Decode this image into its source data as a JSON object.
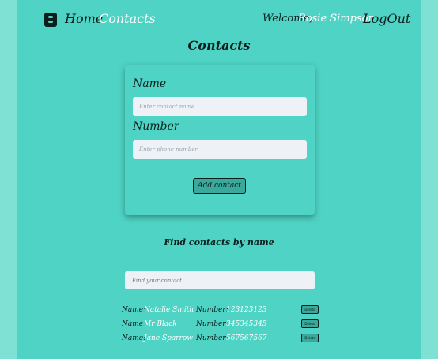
{
  "nav": {
    "home": "Home",
    "contacts": "Contacts",
    "welcome": "Welcome,",
    "user": "Rosie Simpson",
    "logout": "LogOut"
  },
  "page_title": "Contacts",
  "form": {
    "name_label": "Name",
    "name_placeholder": "Enter contact name",
    "number_label": "Number",
    "number_placeholder": "Enter phone number",
    "add_button": "Add contact"
  },
  "find": {
    "title": "Find contacts by name",
    "placeholder": "Find your contact"
  },
  "contacts": {
    "name_label": "Name:",
    "number_label": "Number:",
    "delete_label": "Delete",
    "items": [
      {
        "name": "Natalie Smith",
        "number": "123123123"
      },
      {
        "name": "Mr Black",
        "number": "345345345"
      },
      {
        "name": "Jane Sparrow",
        "number": "567567567"
      }
    ]
  },
  "colors": {
    "background": "#4fd3c4",
    "outer": "#7fe0d4",
    "button": "#3aa89a",
    "input": "#eef1f6",
    "text_dark": "#0b1f1d",
    "text_light": "#ffffff"
  }
}
